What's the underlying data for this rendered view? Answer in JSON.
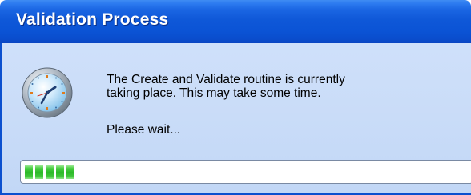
{
  "window": {
    "title": "Validation Process"
  },
  "icons": {
    "status_icon": "clock-icon"
  },
  "message": {
    "line1": "The Create and Validate routine is currently",
    "line2": "taking place. This may take some time.",
    "wait": "Please wait..."
  },
  "progress": {
    "blocks_filled": 5,
    "fill_color": "#2ab827"
  },
  "colors": {
    "titlebar": "#0b54d6",
    "body_background": "#c9dcf8"
  }
}
